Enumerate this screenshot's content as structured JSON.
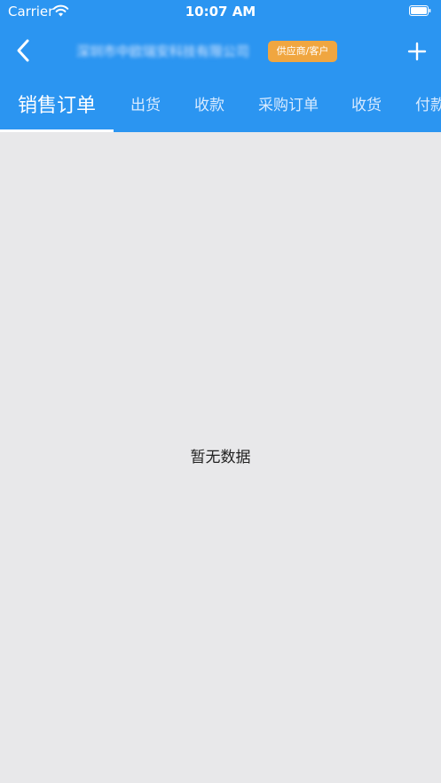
{
  "status_bar": {
    "carrier": "Carrier",
    "time": "10:07 AM",
    "wifi_icon": "wifi-icon",
    "battery_icon": "battery-icon"
  },
  "nav": {
    "back_icon": "chevron-left-icon",
    "title": "深圳市中欧瑞安科技有限公司",
    "badge": "供应商/客户",
    "add_icon": "plus-icon"
  },
  "tabs": [
    {
      "label": "销售订单",
      "active": true
    },
    {
      "label": "出货",
      "active": false
    },
    {
      "label": "收款",
      "active": false
    },
    {
      "label": "采购订单",
      "active": false
    },
    {
      "label": "收货",
      "active": false
    },
    {
      "label": "付款",
      "active": false
    }
  ],
  "content": {
    "empty_text": "暂无数据"
  },
  "colors": {
    "primary": "#2B95F1",
    "badge": "#F0A640",
    "background": "#E8E8EA"
  }
}
